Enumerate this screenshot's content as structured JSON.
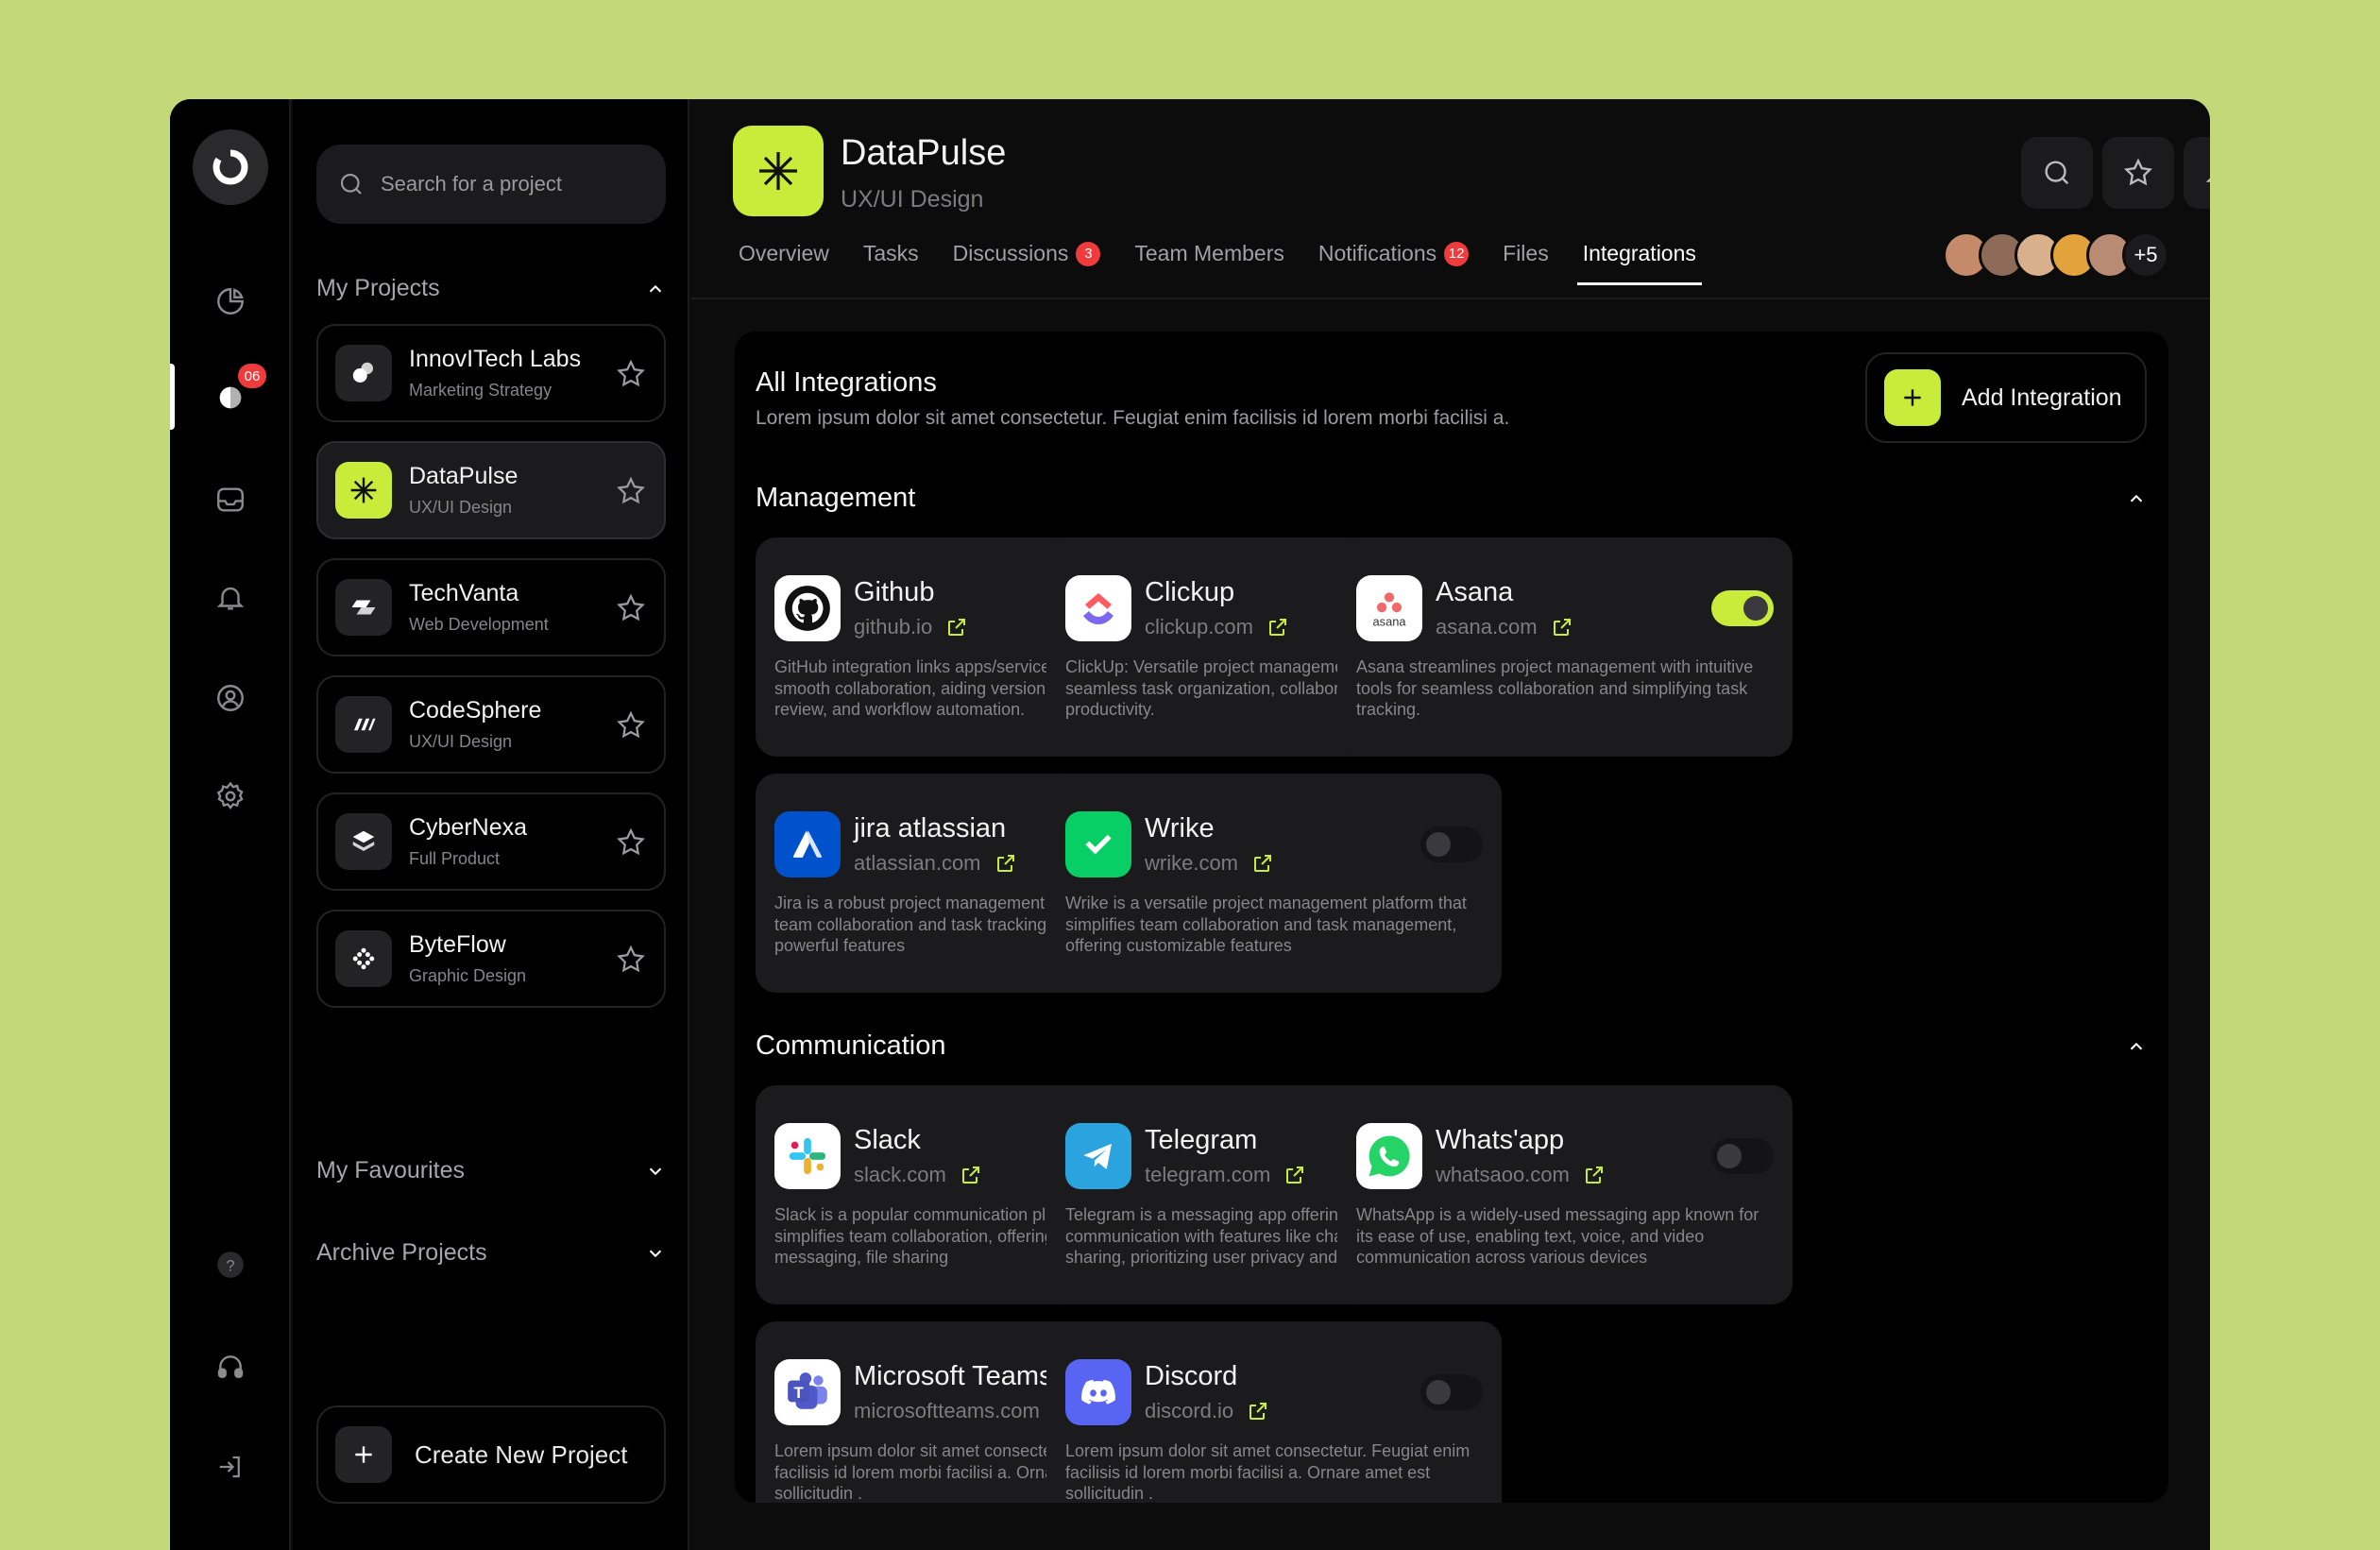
{
  "colors": {
    "accent": "#c9ec3b",
    "badge": "#ef3b3b",
    "background": "#c3d878"
  },
  "rail": {
    "notification_badge": "06",
    "icons": [
      "logo-icon",
      "dashboard-icon",
      "projects-icon",
      "inbox-icon",
      "bell-icon",
      "profile-icon",
      "settings-icon",
      "help-icon",
      "headset-icon",
      "logout-icon"
    ]
  },
  "sidebar": {
    "search_placeholder": "Search for a project",
    "my_projects_label": "My Projects",
    "projects": [
      {
        "name": "InnovITech Labs",
        "type": "Marketing Strategy"
      },
      {
        "name": "DataPulse",
        "type": "UX/UI Design"
      },
      {
        "name": "TechVanta",
        "type": "Web Development"
      },
      {
        "name": "CodeSphere",
        "type": "UX/UI Design"
      },
      {
        "name": "CyberNexa",
        "type": "Full Product"
      },
      {
        "name": "ByteFlow",
        "type": "Graphic Design"
      }
    ],
    "favourites_label": "My Favourites",
    "archive_label": "Archive Projects",
    "create_label": "Create New Project"
  },
  "header": {
    "title": "DataPulse",
    "subtitle": "UX/UI Design",
    "tabs": [
      {
        "label": "Overview"
      },
      {
        "label": "Tasks"
      },
      {
        "label": "Discussions",
        "count": "3"
      },
      {
        "label": "Team Members"
      },
      {
        "label": "Notifications",
        "count": "12"
      },
      {
        "label": "Files"
      },
      {
        "label": "Integrations"
      }
    ],
    "active_tab": "Integrations",
    "members_more": "+5"
  },
  "integrations": {
    "title": "All Integrations",
    "description": "Lorem ipsum dolor sit amet consectetur. Feugiat enim facilisis id lorem morbi facilisi a.",
    "add_label": "Add Integration",
    "management_label": "Management",
    "communication_label": "Communication",
    "management": [
      {
        "name": "Github",
        "domain": "github.io",
        "enabled": true,
        "desc": "GitHub integration links apps/services with GitHub for smooth collaboration, aiding version control, code review, and workflow automation."
      },
      {
        "name": "Clickup",
        "domain": "clickup.com",
        "enabled": false,
        "desc": "ClickUp: Versatile project management platform for seamless task organization, collaboration, and productivity."
      },
      {
        "name": "Asana",
        "domain": "asana.com",
        "enabled": true,
        "desc": "Asana streamlines project management with intuitive tools for seamless collaboration and simplifying task tracking."
      },
      {
        "name": "jira atlassian",
        "domain": "atlassian.com",
        "enabled": false,
        "desc": "Jira is a robust project management tool that facilitates team collaboration and task tracking, equipped with powerful features"
      },
      {
        "name": "Wrike",
        "domain": "wrike.com",
        "enabled": false,
        "desc": "Wrike is a versatile project management platform that simplifies team collaboration and task management, offering customizable features"
      }
    ],
    "communication": [
      {
        "name": "Slack",
        "domain": "slack.com",
        "enabled": true,
        "desc": "Slack is a popular communication platform that simplifies team collaboration, offering real-time messaging, file sharing"
      },
      {
        "name": "Telegram",
        "domain": "telegram.com",
        "enabled": false,
        "desc": "Telegram is a messaging app offering secure, fast communication with features like chats, groups, and file sharing, prioritizing user privacy and versatility."
      },
      {
        "name": "Whats'app",
        "domain": "whatsaoo.com",
        "enabled": false,
        "desc": "WhatsApp is a widely-used messaging app known for its ease of use, enabling text, voice, and video communication across various devices"
      },
      {
        "name": "Microsoft Teams",
        "domain": "microsoftteams.com",
        "enabled": false,
        "desc": "Lorem ipsum dolor sit amet consectetur. Feugiat enim facilisis id lorem morbi facilisi a. Ornare amet est sollicitudin ."
      },
      {
        "name": "Discord",
        "domain": "discord.io",
        "enabled": false,
        "desc": "Lorem ipsum dolor sit amet consectetur. Feugiat enim facilisis id lorem morbi facilisi a. Ornare amet est sollicitudin ."
      }
    ]
  }
}
